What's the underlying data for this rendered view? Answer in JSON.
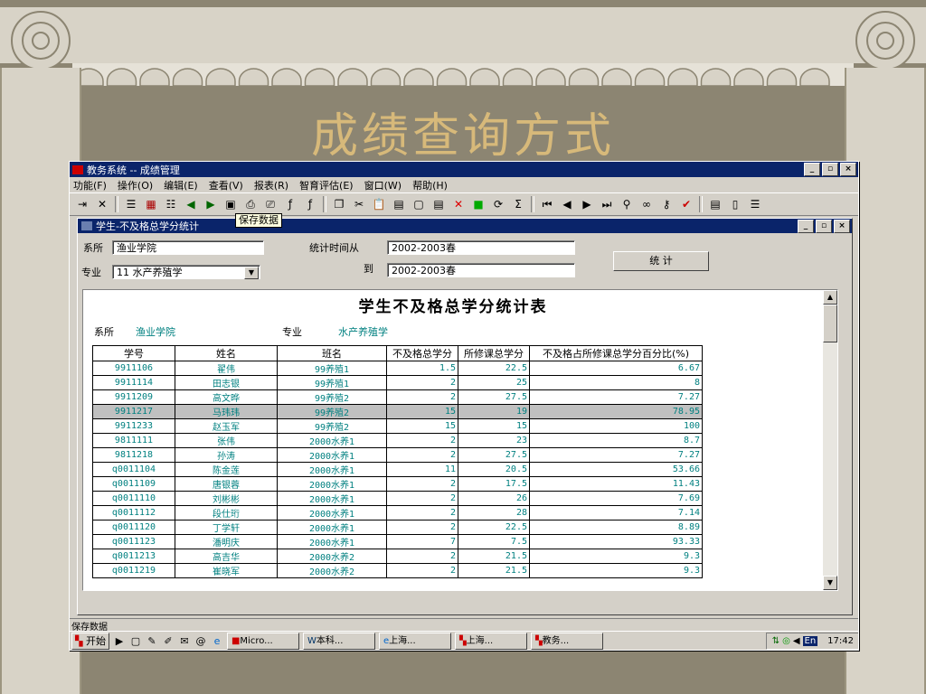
{
  "slide": {
    "title": "成绩查询方式"
  },
  "window": {
    "title": "教务系统 -- 成绩管理",
    "controls": [
      "_",
      "▫",
      "×"
    ],
    "menu": [
      "功能(F)",
      "操作(O)",
      "编辑(E)",
      "查看(V)",
      "报表(R)",
      "智育评估(E)",
      "窗口(W)",
      "帮助(H)"
    ]
  },
  "child": {
    "title": "学生-不及格总学分统计",
    "tooltip": "保存数据",
    "dept_label": "系所",
    "dept_value": "渔业学院",
    "major_label": "专业",
    "major_value": "11 水产养殖学",
    "period_from_label": "统计时间从",
    "period_from": "2002-2003春",
    "period_to_label": "到",
    "period_to": "2002-2003春",
    "stat_button": "统 计"
  },
  "report": {
    "title": "学生不及格总学分统计表",
    "dept_label": "系所",
    "dept_value": "渔业学院",
    "major_label": "专业",
    "major_value": "水产养殖学",
    "headers": [
      "学号",
      "姓名",
      "班名",
      "不及格总学分",
      "所修课总学分",
      "不及格占所修课总学分百分比(%)"
    ],
    "rows": [
      [
        "9911106",
        "翟伟",
        "99养殖1",
        "1.5",
        "22.5",
        "6.67"
      ],
      [
        "9911114",
        "田志银",
        "99养殖1",
        "2",
        "25",
        "8"
      ],
      [
        "9911209",
        "高文晔",
        "99养殖2",
        "2",
        "27.5",
        "7.27"
      ],
      [
        "9911217",
        "马玮玮",
        "99养殖2",
        "15",
        "19",
        "78.95"
      ],
      [
        "9911233",
        "赵玉军",
        "99养殖2",
        "15",
        "15",
        "100"
      ],
      [
        "9811111",
        "张伟",
        "2000水养1",
        "2",
        "23",
        "8.7"
      ],
      [
        "9811218",
        "孙涛",
        "2000水养1",
        "2",
        "27.5",
        "7.27"
      ],
      [
        "q0011104",
        "陈金莲",
        "2000水养1",
        "11",
        "20.5",
        "53.66"
      ],
      [
        "q0011109",
        "唐银蓉",
        "2000水养1",
        "2",
        "17.5",
        "11.43"
      ],
      [
        "q0011110",
        "刘彬彬",
        "2000水养1",
        "2",
        "26",
        "7.69"
      ],
      [
        "q0011112",
        "段仕珩",
        "2000水养1",
        "2",
        "28",
        "7.14"
      ],
      [
        "q0011120",
        "丁学轩",
        "2000水养1",
        "2",
        "22.5",
        "8.89"
      ],
      [
        "q0011123",
        "潘明庆",
        "2000水养1",
        "7",
        "7.5",
        "93.33"
      ],
      [
        "q0011213",
        "高吉华",
        "2000水养2",
        "2",
        "21.5",
        "9.3"
      ],
      [
        "q0011219",
        "崔晓军",
        "2000水养2",
        "2",
        "21.5",
        "9.3"
      ]
    ],
    "selected_row": 3
  },
  "status": {
    "text": "保存数据"
  },
  "taskbar": {
    "start": "开始",
    "tasks": [
      "Micro...",
      "本科...",
      "上海...",
      "上海...",
      "教务..."
    ],
    "lang": "En",
    "clock": "17:42"
  }
}
